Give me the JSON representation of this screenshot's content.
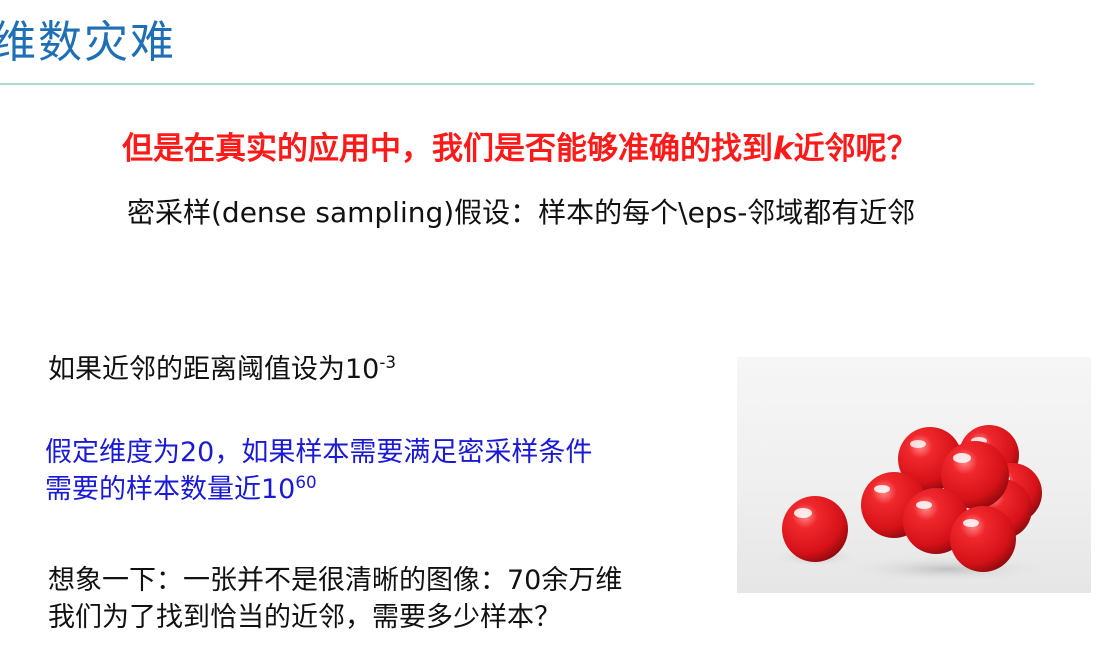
{
  "slide": {
    "title": "维数灾难",
    "question": {
      "before": "但是在真实的应用中，我们是否能够准确的找到",
      "k": "k",
      "after": "近邻呢？"
    },
    "assumption": "密采样(dense sampling)假设：样本的每个\\eps-邻域都有近邻",
    "threshold": {
      "text": "如果近邻的距离阈值设为10",
      "exponent": "-3"
    },
    "dimension": {
      "line1": "假定维度为20，如果样本需要满足密采样条件",
      "line2_text": "需要的样本数量近10",
      "line2_exponent": "60"
    },
    "imagine": {
      "line1": "想象一下：一张并不是很清晰的图像：70余万维",
      "line2": "我们为了找到恰当的近邻，需要多少样本？"
    }
  },
  "colors": {
    "title": "#1f6fb4",
    "rule": "#a9dccb",
    "question": "#ff1a1a",
    "emphasis_blue": "#1a1ad6",
    "ball_red": "#e8191e"
  },
  "image": {
    "subject": "red balls photo"
  }
}
